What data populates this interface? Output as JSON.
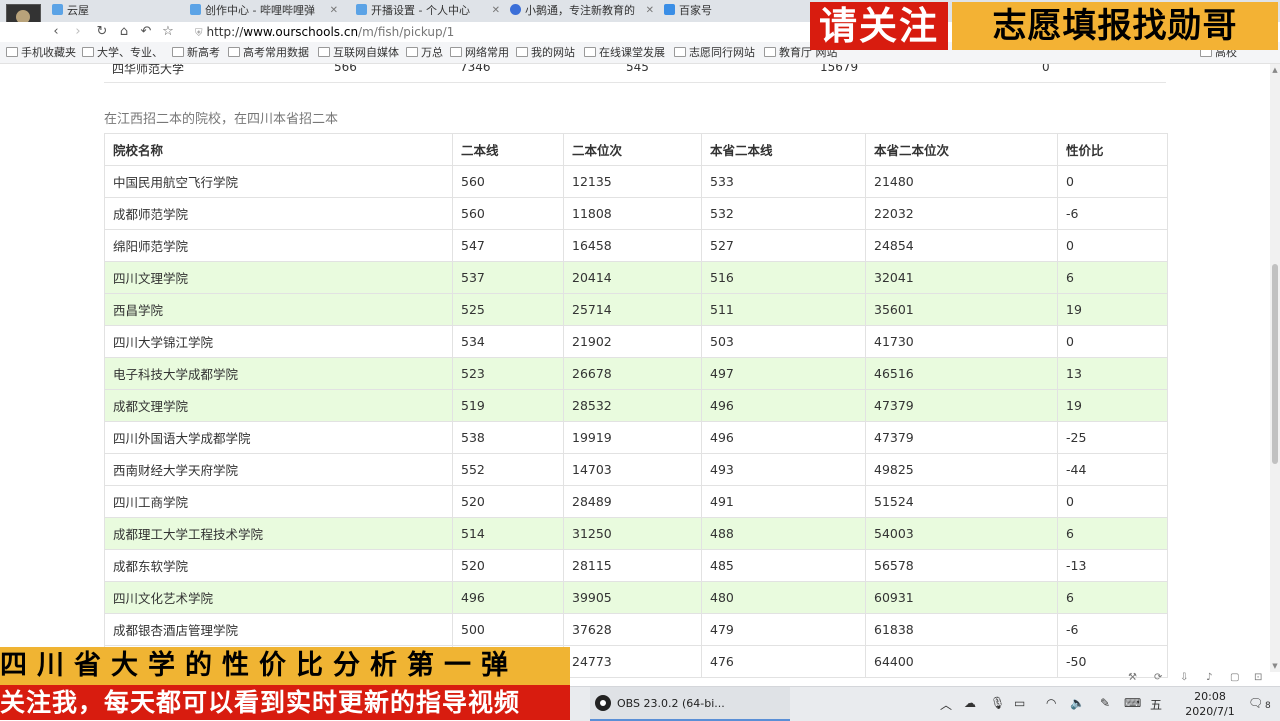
{
  "browser": {
    "tabs": [
      {
        "label": "云屋",
        "color": "#5ba3e6"
      },
      {
        "label": "创作中心 - 哔哩哔哩弹",
        "color": "#5ba3e6"
      },
      {
        "label": "开播设置 - 个人中心",
        "color": "#5ba3e6"
      },
      {
        "label": "小鹅通，专注新教育的",
        "color": "#3b6fd8"
      },
      {
        "label": "百家号",
        "color": "#3a8ee6"
      }
    ],
    "url": {
      "prefix": "http://",
      "domain": "www.ourschools.cn",
      "path": "/m/fish/pickup/1"
    },
    "bookmarks": [
      "手机收藏夹",
      "大学、专业、",
      "新高考",
      "高考常用数据",
      "互联网自媒体",
      "万总",
      "网络常用",
      "我的网站",
      "在线课堂发展",
      "志愿同行网站",
      "教育厅 网站",
      "高校"
    ]
  },
  "banner": {
    "left": "请关注",
    "right": "志愿填报找勋哥"
  },
  "top_row": {
    "name": "四华师范大学",
    "values": [
      "566",
      "7346",
      "545",
      "15679",
      "0"
    ]
  },
  "subtitle": "在江西招二本的院校，在四川本省招二本",
  "table": {
    "headers": [
      "院校名称",
      "二本线",
      "二本位次",
      "本省二本线",
      "本省二本位次",
      "性价比"
    ],
    "rows": [
      {
        "cells": [
          "中国民用航空飞行学院",
          "560",
          "12135",
          "533",
          "21480",
          "0"
        ],
        "highlight": false
      },
      {
        "cells": [
          "成都师范学院",
          "560",
          "11808",
          "532",
          "22032",
          "-6"
        ],
        "highlight": false
      },
      {
        "cells": [
          "绵阳师范学院",
          "547",
          "16458",
          "527",
          "24854",
          "0"
        ],
        "highlight": false
      },
      {
        "cells": [
          "四川文理学院",
          "537",
          "20414",
          "516",
          "32041",
          "6"
        ],
        "highlight": true
      },
      {
        "cells": [
          "西昌学院",
          "525",
          "25714",
          "511",
          "35601",
          "19"
        ],
        "highlight": true
      },
      {
        "cells": [
          "四川大学锦江学院",
          "534",
          "21902",
          "503",
          "41730",
          "0"
        ],
        "highlight": false
      },
      {
        "cells": [
          "电子科技大学成都学院",
          "523",
          "26678",
          "497",
          "46516",
          "13"
        ],
        "highlight": true
      },
      {
        "cells": [
          "成都文理学院",
          "519",
          "28532",
          "496",
          "47379",
          "19"
        ],
        "highlight": true
      },
      {
        "cells": [
          "四川外国语大学成都学院",
          "538",
          "19919",
          "496",
          "47379",
          "-25"
        ],
        "highlight": false
      },
      {
        "cells": [
          "西南财经大学天府学院",
          "552",
          "14703",
          "493",
          "49825",
          "-44"
        ],
        "highlight": false
      },
      {
        "cells": [
          "四川工商学院",
          "520",
          "28489",
          "491",
          "51524",
          "0"
        ],
        "highlight": false
      },
      {
        "cells": [
          "成都理工大学工程技术学院",
          "514",
          "31250",
          "488",
          "54003",
          "6"
        ],
        "highlight": true
      },
      {
        "cells": [
          "成都东软学院",
          "520",
          "28115",
          "485",
          "56578",
          "-13"
        ],
        "highlight": false
      },
      {
        "cells": [
          "四川文化艺术学院",
          "496",
          "39905",
          "480",
          "60931",
          "6"
        ],
        "highlight": true
      },
      {
        "cells": [
          "成都银杏酒店管理学院",
          "500",
          "37628",
          "479",
          "61838",
          "-6"
        ],
        "highlight": false
      },
      {
        "cells": [
          "",
          "",
          "24773",
          "476",
          "64400",
          "-50"
        ],
        "highlight": false
      }
    ]
  },
  "captions": {
    "line1": "四川省大学的性价比分析第一弹",
    "line2": "关注我，每天都可以看到实时更新的指导视频"
  },
  "taskbar": {
    "app_label": "OBS 23.0.2 (64-bi...",
    "ime": "五",
    "time": "20:08",
    "date": "2020/7/1",
    "notification_count": "8"
  },
  "colors": {
    "highlight_row": "#e9fbde",
    "banner_red": "#d81c0f",
    "banner_yellow": "#f3b234"
  }
}
